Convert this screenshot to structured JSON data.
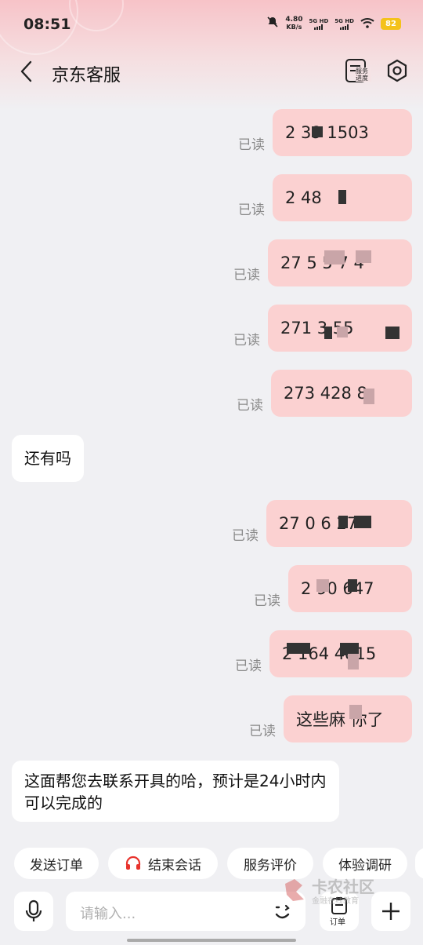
{
  "status_bar": {
    "time": "08:51",
    "net_speed": "4.80",
    "net_unit": "KB/s",
    "sim1": "5G HD",
    "sim2": "5G HD",
    "battery": "82"
  },
  "header": {
    "title": "京东客服",
    "service_progress": "服务进度"
  },
  "messages": {
    "read_label": "已读",
    "out": [
      {
        "text": "2  39 1503"
      },
      {
        "text": "2      48"
      },
      {
        "text": "27  5  5 7 4"
      },
      {
        "text": "271  3   55"
      },
      {
        "text": "273  428  8"
      },
      {
        "text": "27   0 6  27"
      },
      {
        "text": "2   90    647"
      },
      {
        "text": "2 164  4815"
      },
      {
        "text": "这些麻 你了"
      }
    ],
    "in": [
      {
        "text": "还有吗"
      },
      {
        "text": "这面帮您去联系开具的哈，预计是24小时内可以完成的"
      }
    ]
  },
  "quick_actions": [
    {
      "label": "发送订单"
    },
    {
      "label": "结束会话"
    },
    {
      "label": "服务评价"
    },
    {
      "label": "体验调研"
    }
  ],
  "input": {
    "placeholder": "请输入...",
    "order_label": "订单"
  },
  "watermark": {
    "main": "卡农社区",
    "sub": "金融在线教育"
  },
  "colors": {
    "bubble_out": "#fbd1d1",
    "bubble_in": "#ffffff",
    "end_chat_icon": "#e8332d",
    "battery": "#f4c21a"
  }
}
